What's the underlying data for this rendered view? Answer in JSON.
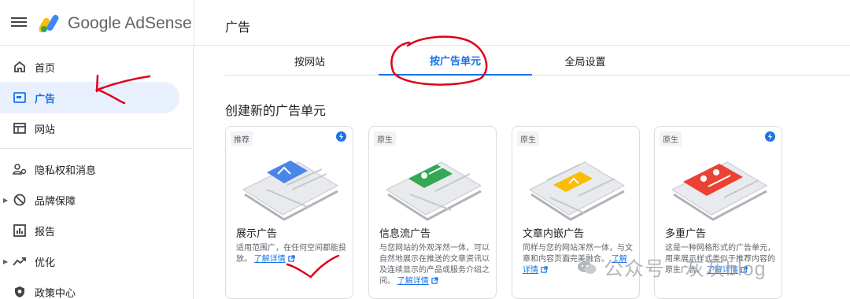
{
  "header": {
    "brand": "Google AdSense",
    "page_title": "广告"
  },
  "sidebar": {
    "items": [
      {
        "label": "首页",
        "icon": "home-icon"
      },
      {
        "label": "广告",
        "icon": "ads-icon",
        "active": true
      },
      {
        "label": "网站",
        "icon": "sites-icon"
      },
      {
        "label": "隐私权和消息",
        "icon": "privacy-icon"
      },
      {
        "label": "品牌保障",
        "icon": "block-icon"
      },
      {
        "label": "报告",
        "icon": "reports-icon"
      },
      {
        "label": "优化",
        "icon": "optimize-icon"
      },
      {
        "label": "政策中心",
        "icon": "policy-icon"
      }
    ]
  },
  "tabs": [
    {
      "label": "按网站"
    },
    {
      "label": "按广告单元",
      "active": true
    },
    {
      "label": "全局设置"
    }
  ],
  "section_title": "创建新的广告单元",
  "cards": [
    {
      "badge": "推荐",
      "title": "展示广告",
      "desc": "适用范围广，在任何空间都能投放。",
      "link": "了解详情",
      "accent": "#4a86e8"
    },
    {
      "badge": "原生",
      "title": "信息流广告",
      "desc": "与您网站的外观浑然一体，可以自然地展示在推送的文章资讯以及连续显示的产品或服务介绍之间。",
      "link": "了解详情",
      "accent": "#34a853"
    },
    {
      "badge": "原生",
      "title": "文章内嵌广告",
      "desc": "同样与您的网站浑然一体，与文章和内容页面完美融合。",
      "link": "了解详情",
      "accent": "#fbbc04"
    },
    {
      "badge": "原生",
      "title": "多重广告",
      "desc": "这是一种网格形式的广告单元，用来展示样式类似于推荐内容的原生广告。",
      "link": "了解详情",
      "accent": "#ea4335"
    }
  ],
  "watermark": "公众号 · 灰灰blog",
  "colors": {
    "primary": "#1a73e8",
    "annotation": "#e0001b"
  }
}
